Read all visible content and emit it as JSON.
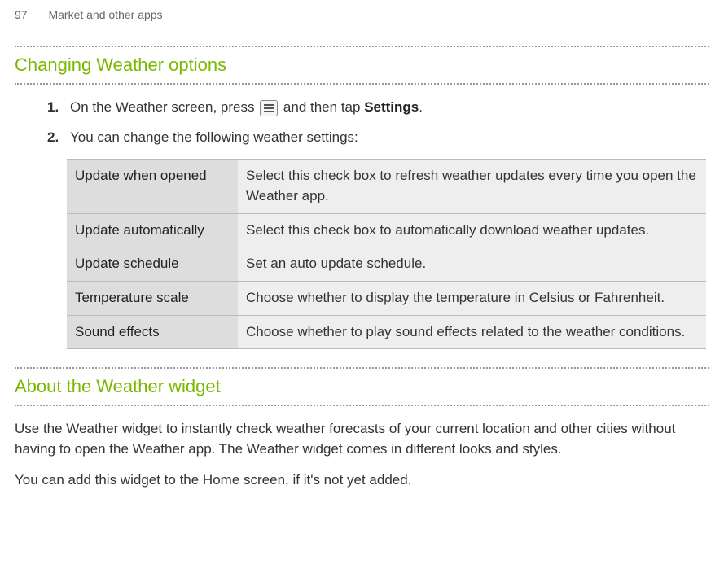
{
  "header": {
    "page_number": "97",
    "chapter": "Market and other apps"
  },
  "section1": {
    "heading": "Changing Weather options",
    "steps": {
      "s1_num": "1.",
      "s1_pre": "On the Weather screen, press ",
      "s1_mid": " and then tap ",
      "s1_bold": "Settings",
      "s1_post": ".",
      "s2_num": "2.",
      "s2_text": "You can change the following weather settings:"
    },
    "table": [
      {
        "label": "Update when opened",
        "desc": "Select this check box to refresh weather updates every time you open the Weather app."
      },
      {
        "label": "Update automatically",
        "desc": "Select this check box to automatically download weather updates."
      },
      {
        "label": "Update schedule",
        "desc": "Set an auto update schedule."
      },
      {
        "label": "Temperature scale",
        "desc": "Choose whether to display the temperature in Celsius or Fahrenheit."
      },
      {
        "label": "Sound effects",
        "desc": "Choose whether to play sound effects related to the weather conditions."
      }
    ]
  },
  "section2": {
    "heading": "About the Weather widget",
    "para1": "Use the Weather widget to instantly check weather forecasts of your current location and other cities without having to open the Weather app. The Weather widget comes in different looks and styles.",
    "para2": "You can add this widget to the Home screen, if it's not yet added."
  }
}
